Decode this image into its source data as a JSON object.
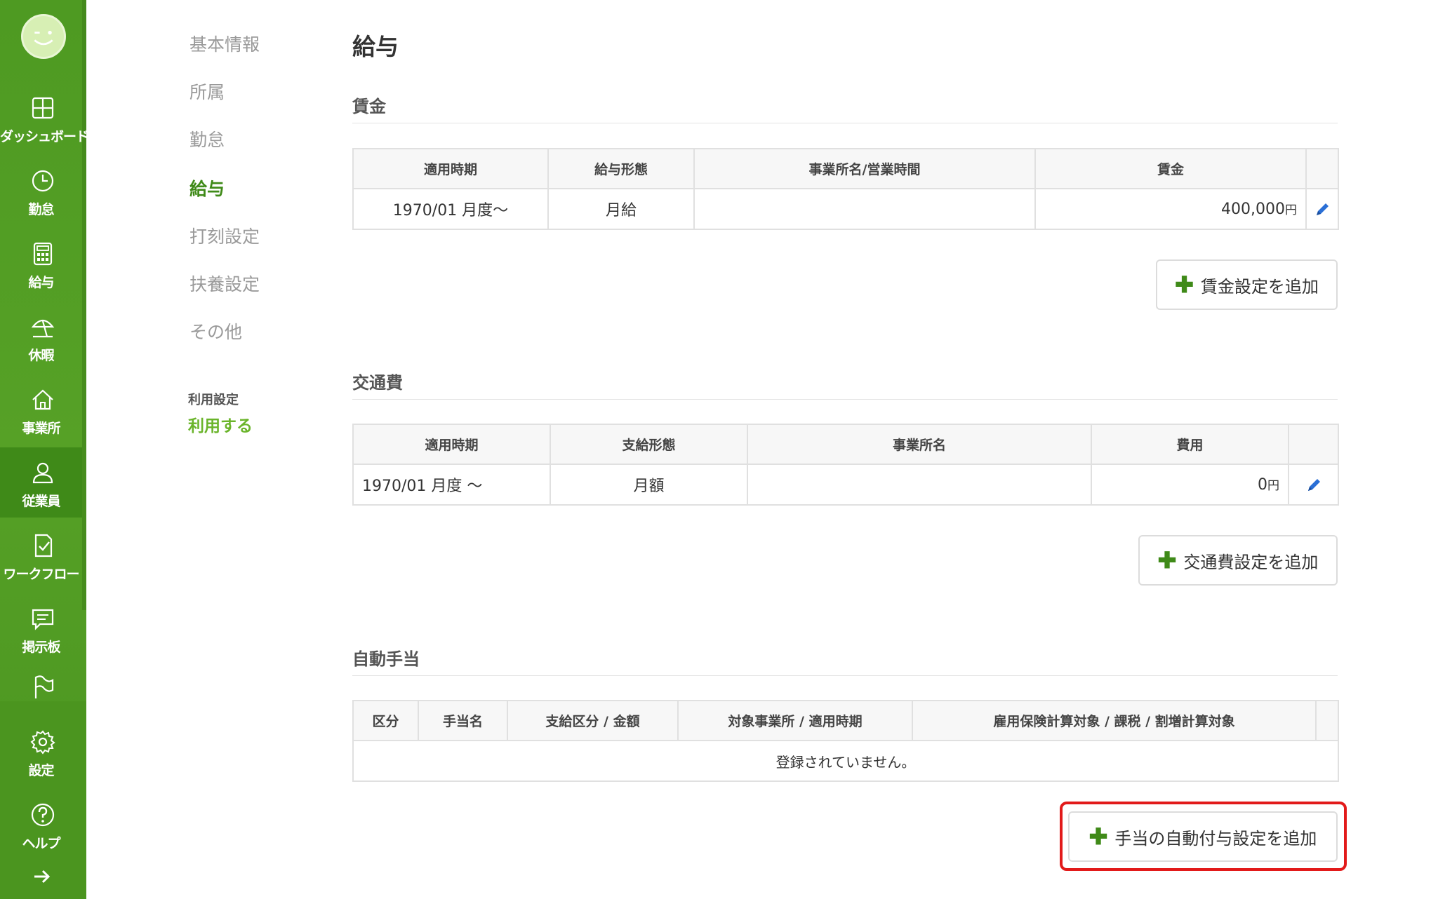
{
  "sidebar": {
    "items": [
      {
        "label": "ダッシュボード",
        "icon": "dashboard-icon"
      },
      {
        "label": "勤怠",
        "icon": "clock-icon"
      },
      {
        "label": "給与",
        "icon": "calculator-icon"
      },
      {
        "label": "休暇",
        "icon": "beach-umbrella-icon"
      },
      {
        "label": "事業所",
        "icon": "home-icon"
      },
      {
        "label": "従業員",
        "icon": "person-icon"
      },
      {
        "label": "ワークフロー",
        "icon": "document-check-icon"
      },
      {
        "label": "掲示板",
        "icon": "chat-bubble-icon"
      },
      {
        "label": "",
        "icon": "flag-icon"
      },
      {
        "label": "設定",
        "icon": "gear-icon"
      },
      {
        "label": "ヘルプ",
        "icon": "help-circle-icon"
      }
    ],
    "active_index": 5,
    "accent": "#4e9a22"
  },
  "subnav": {
    "items": [
      "基本情報",
      "所属",
      "勤怠",
      "給与",
      "打刻設定",
      "扶養設定",
      "その他"
    ],
    "current": "給与",
    "usage_label": "利用設定",
    "usage_value": "利用する"
  },
  "main": {
    "title": "給与",
    "wage": {
      "title": "賃金",
      "headers": [
        "適用時期",
        "給与形態",
        "事業所名/営業時間",
        "賃金"
      ],
      "rows": [
        {
          "period": "1970/01 月度〜",
          "type": "月給",
          "office": "",
          "amount": "400,000",
          "unit": "円"
        }
      ],
      "add_label": "賃金設定を追加"
    },
    "transport": {
      "title": "交通費",
      "headers": [
        "適用時期",
        "支給形態",
        "事業所名",
        "費用"
      ],
      "rows": [
        {
          "period": "1970/01 月度 〜",
          "type": "月額",
          "office": "",
          "amount": "0",
          "unit": "円"
        }
      ],
      "add_label": "交通費設定を追加"
    },
    "allowance": {
      "title": "自動手当",
      "headers": [
        "区分",
        "手当名",
        "支給区分 / 金額",
        "対象事業所 / 適用時期",
        "雇用保険計算対象 / 課税 / 割増計算対象"
      ],
      "empty_message": "登録されていません。",
      "add_label": "手当の自動付与設定を追加"
    }
  },
  "colors": {
    "highlight": "#e21a1a",
    "plus": "#3f8a18",
    "edit": "#2a6fd6"
  }
}
